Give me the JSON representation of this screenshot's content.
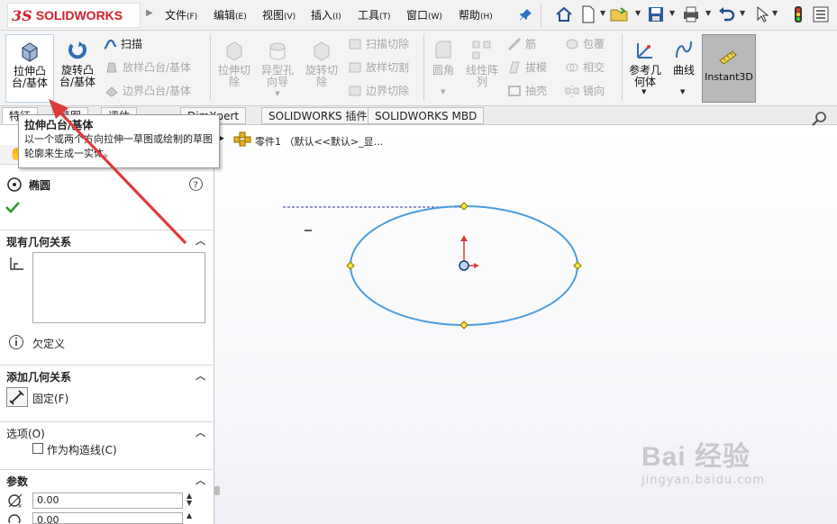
{
  "app": {
    "logo_ds": "3S",
    "logo_text": "SOLIDWORKS"
  },
  "menu": [
    {
      "label": "文件",
      "key": "(F)"
    },
    {
      "label": "编辑",
      "key": "(E)"
    },
    {
      "label": "视图",
      "key": "(V)"
    },
    {
      "label": "插入",
      "key": "(I)"
    },
    {
      "label": "工具",
      "key": "(T)"
    },
    {
      "label": "窗口",
      "key": "(W)"
    },
    {
      "label": "帮助",
      "key": "(H)"
    }
  ],
  "ribbon": {
    "extrude_boss": "拉伸凸\n台/基体",
    "revolve_boss": "旋转凸\n台/基体",
    "sweep": "扫描",
    "loft_boss": "放样凸台/基体",
    "boundary_boss": "边界凸台/基体",
    "extrude_cut": "拉伸切\n除",
    "hole_wizard": "异型孔\n向导",
    "revolve_cut": "旋转切\n除",
    "sweep_cut": "扫描切除",
    "loft_cut": "放样切割",
    "boundary_cut": "边界切除",
    "fillet": "圆角",
    "linear_pattern": "线性阵\n列",
    "rib": "筋",
    "draft": "拔模",
    "shell": "抽壳",
    "wrap": "包覆",
    "intersect": "相交",
    "mirror": "镜向",
    "ref_geometry": "参考几\n何体",
    "curves": "曲线",
    "instant3d": "Instant3D"
  },
  "tabs": [
    "特征",
    "草图",
    "评估",
    "DimXpert",
    "SOLIDWORKS 插件",
    "SOLIDWORKS MBD"
  ],
  "tooltip": {
    "title": "拉伸凸台/基体",
    "body": "以一个或两个方向拉伸一草图或绘制的草图轮廓来生成一实体。"
  },
  "tree": {
    "part_label": "零件1 （默认<<默认>_显..."
  },
  "property_manager": {
    "title": "椭圆",
    "existing_relations": "现有几何关系",
    "status": "欠定义",
    "add_relations": "添加几何关系",
    "fix_label": "固定(F)",
    "options": "选项(O)",
    "construction_label": "作为构造线(C)",
    "parameters": "参数",
    "param1_value": "0.00",
    "param2_value": "0.00"
  },
  "watermark": {
    "brand": "Bai 经验",
    "url": "jingyan.baidu.com"
  },
  "colors": {
    "brand_red": "#d0202a",
    "ellipse_blue": "#4a9ee0",
    "point_yellow": "#f5e63a",
    "arrow_red": "#e03c3c"
  }
}
